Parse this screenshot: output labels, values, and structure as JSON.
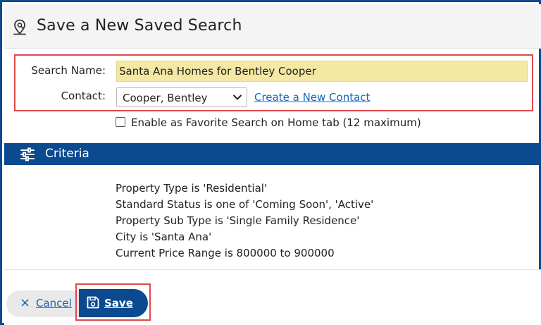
{
  "dialog": {
    "title": "Save a New Saved Search",
    "title_icon": "search-location-icon"
  },
  "form": {
    "search_name_label": "Search Name:",
    "search_name_value": "Santa Ana Homes for Bentley Cooper",
    "contact_label": "Contact:",
    "contact_value": "Cooper, Bentley",
    "create_contact_link": "Create a New Contact",
    "favorite_checked": false,
    "favorite_label": "Enable as Favorite Search on Home tab (12 maximum)"
  },
  "criteria": {
    "header": "Criteria",
    "header_icon": "sliders-icon",
    "items": [
      "Property Type is 'Residential'",
      "Standard Status is one of 'Coming Soon', 'Active'",
      "Property Sub Type is 'Single Family Residence'",
      "City is 'Santa Ana'",
      "Current Price Range is 800000 to 900000"
    ]
  },
  "footer": {
    "cancel_icon": "×",
    "cancel_label": "Cancel",
    "save_label": "Save",
    "save_icon": "floppy-disk-icon"
  },
  "colors": {
    "brand_blue": "#0b4a8f",
    "highlight_red": "#e0474c",
    "input_yellow": "#f5e8a3",
    "link_blue": "#1565c0"
  }
}
